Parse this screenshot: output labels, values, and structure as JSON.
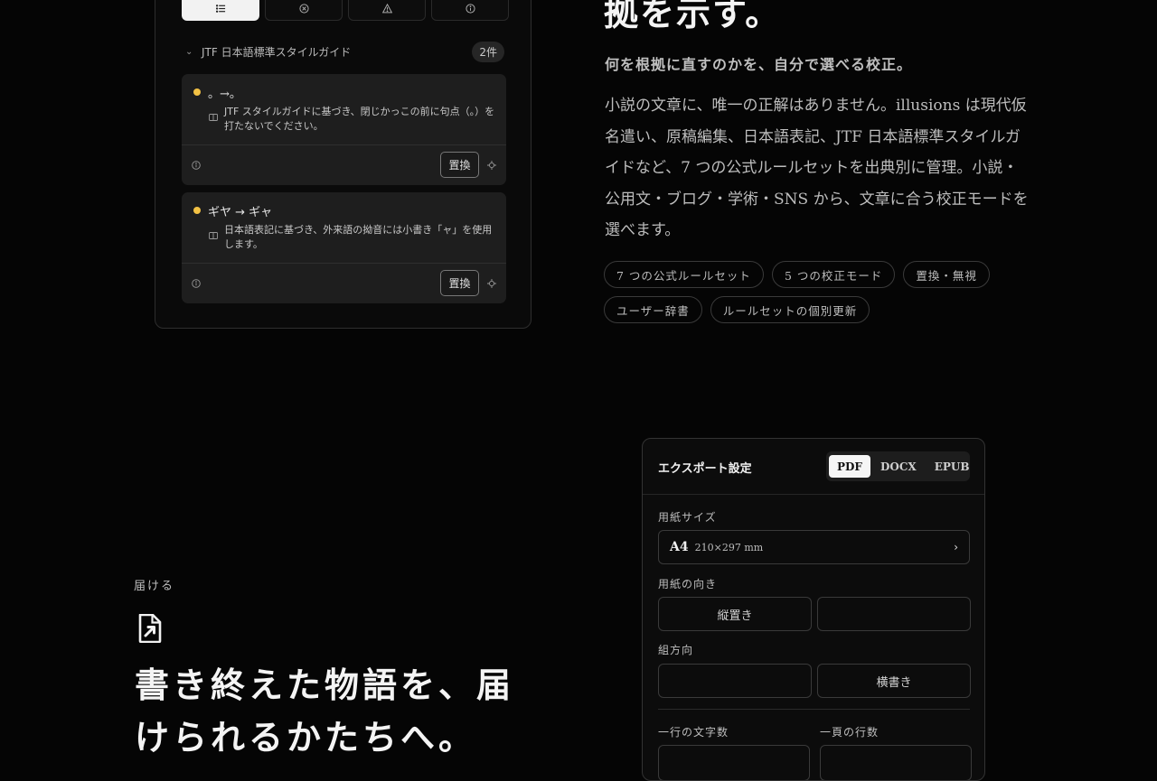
{
  "proofing": {
    "filter_tabs": [
      {
        "icon": "list-icon",
        "active": true
      },
      {
        "icon": "x-circle-icon",
        "active": false
      },
      {
        "icon": "warning-icon",
        "active": false
      },
      {
        "icon": "info-icon",
        "active": false
      }
    ],
    "group": {
      "name": "JTF 日本語標準スタイルガイド",
      "count": "2件"
    },
    "issues": [
      {
        "title": "。→。",
        "desc": "JTF スタイルガイドに基づき、閉じかっこの前に句点（。）を打たないでください。",
        "replace_label": "置換"
      },
      {
        "title": "ギヤ → ギャ",
        "desc": "日本語表記に基づき、外来語の拗音には小書き「ャ」を使用します。",
        "replace_label": "置換"
      }
    ]
  },
  "hero": {
    "title": "拠を示す。",
    "subtitle": "何を根拠に直すのかを、自分で選べる校正。",
    "body": "小説の文章に、唯一の正解はありません。illusions は現代仮名遣い、原稿編集、日本語表記、JTF 日本語標準スタイルガイドなど、7 つの公式ルールセットを出典別に管理。小説・公用文・ブログ・学術・SNS から、文章に合う校正モードを選べます。",
    "chips": [
      "7 つの公式ルールセット",
      "5 つの校正モード",
      "置換・無視",
      "ユーザー辞書",
      "ルールセットの個別更新"
    ]
  },
  "deliver": {
    "eyebrow": "届ける",
    "title": "書き終えた物語を、届けられるかたちへ。"
  },
  "export": {
    "title": "エクスポート設定",
    "formats": [
      "PDF",
      "DOCX",
      "EPUB"
    ],
    "active_format": "PDF",
    "paper_size_label": "用紙サイズ",
    "paper_size": "A4",
    "paper_size_dims": "210×297 mm",
    "orientation_label": "用紙の向き",
    "orientation_options": [
      "縦置き",
      ""
    ],
    "direction_label": "組方向",
    "direction_options": [
      "",
      "横書き"
    ],
    "chars_per_line_label": "一行の文字数",
    "lines_per_page_label": "一頁の行数"
  }
}
